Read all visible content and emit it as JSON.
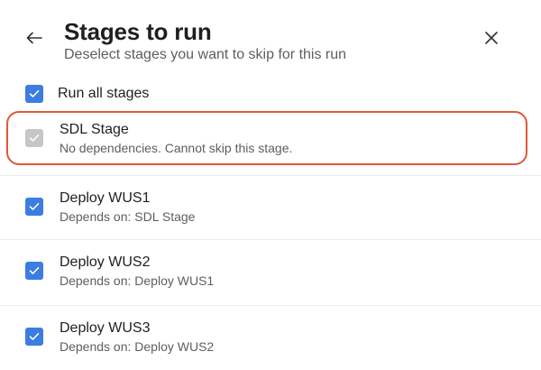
{
  "header": {
    "title": "Stages to run",
    "subtitle": "Deselect stages you want to skip for this run"
  },
  "run_all": {
    "label": "Run all stages",
    "checked": true
  },
  "stages": [
    {
      "name": "SDL Stage",
      "description": "No dependencies. Cannot skip this stage.",
      "checked": true,
      "disabled": true
    },
    {
      "name": "Deploy WUS1",
      "description": "Depends on: SDL Stage",
      "checked": true,
      "disabled": false
    },
    {
      "name": "Deploy WUS2",
      "description": "Depends on: Deploy WUS1",
      "checked": true,
      "disabled": false
    },
    {
      "name": "Deploy WUS3",
      "description": "Depends on: Deploy WUS2",
      "checked": true,
      "disabled": false
    }
  ],
  "icons": {
    "back": "arrow-left-icon",
    "close": "close-icon",
    "check": "checkmark-icon"
  },
  "colors": {
    "accent": "#3b7de0",
    "disabled": "#c8c6c4",
    "highlight": "#e0583a"
  }
}
